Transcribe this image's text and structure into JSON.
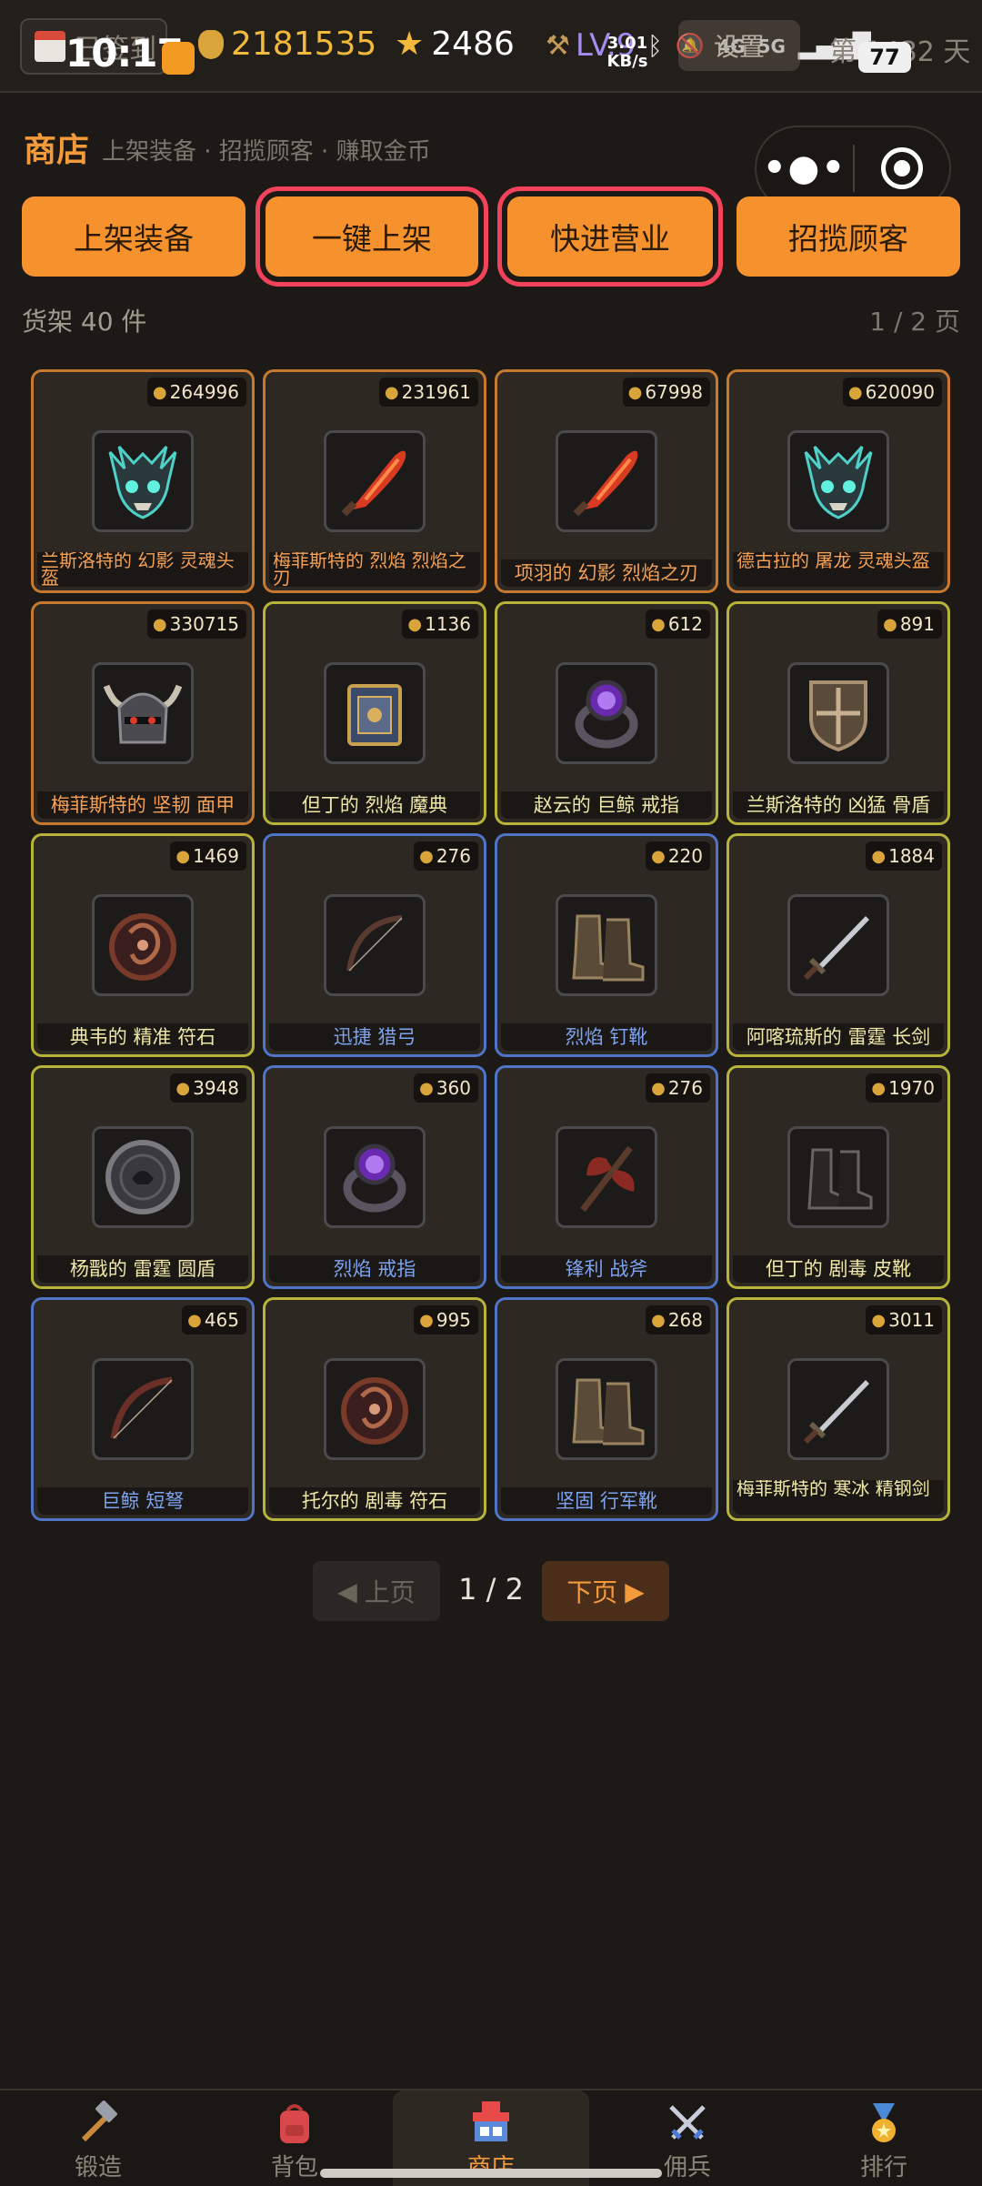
{
  "status_bar": {
    "clock": "10:17",
    "checkin_label": "已签到",
    "gold": "2181535",
    "stars": "2486",
    "level": "LV.9",
    "net_speed_value": "3.01",
    "net_speed_unit": "KB/s",
    "network_labels": [
      "4G",
      "5G"
    ],
    "settings_label": "设置",
    "day_count": "第 1432 天",
    "battery": "77"
  },
  "header": {
    "title": "商店",
    "subtitle": "上架装备 · 招揽顾客 · 赚取金币"
  },
  "actions": [
    {
      "label": "上架装备",
      "highlighted": false
    },
    {
      "label": "一键上架",
      "highlighted": true
    },
    {
      "label": "快进营业",
      "highlighted": true
    },
    {
      "label": "招揽顾客",
      "highlighted": false
    }
  ],
  "shelf": {
    "count_label": "货架 40 件",
    "page_label": "1 / 2 页"
  },
  "items": [
    {
      "price": "264996",
      "name": "兰斯洛特的 幻影 灵魂头盔",
      "quality": "orange",
      "icon": "demon-helm-icon"
    },
    {
      "price": "231961",
      "name": "梅菲斯特的 烈焰 烈焰之刃",
      "quality": "orange",
      "icon": "flame-blade-icon"
    },
    {
      "price": "67998",
      "name": "项羽的 幻影 烈焰之刃",
      "quality": "orange",
      "icon": "flame-blade-icon"
    },
    {
      "price": "620090",
      "name": "德古拉的 屠龙 灵魂头盔",
      "quality": "orange",
      "icon": "demon-helm-icon"
    },
    {
      "price": "330715",
      "name": "梅菲斯特的 坚韧 面甲",
      "quality": "orange",
      "icon": "horned-helmet-icon"
    },
    {
      "price": "1136",
      "name": "但丁的 烈焰 魔典",
      "quality": "yellow",
      "icon": "tome-icon"
    },
    {
      "price": "612",
      "name": "赵云的 巨鲸 戒指",
      "quality": "yellow",
      "icon": "purple-ring-icon"
    },
    {
      "price": "891",
      "name": "兰斯洛特的 凶猛 骨盾",
      "quality": "yellow",
      "icon": "bone-shield-icon"
    },
    {
      "price": "1469",
      "name": "典韦的 精准 符石",
      "quality": "yellow",
      "icon": "rune-stone-icon"
    },
    {
      "price": "276",
      "name": "迅捷 猎弓",
      "quality": "blue",
      "icon": "bow-icon"
    },
    {
      "price": "220",
      "name": "烈焰 钉靴",
      "quality": "blue",
      "icon": "boots-icon"
    },
    {
      "price": "1884",
      "name": "阿喀琉斯的 雷霆 长剑",
      "quality": "yellow",
      "icon": "longsword-icon"
    },
    {
      "price": "3948",
      "name": "杨戬的 雷霆 圆盾",
      "quality": "yellow",
      "icon": "round-shield-icon"
    },
    {
      "price": "360",
      "name": "烈焰 戒指",
      "quality": "blue",
      "icon": "purple-ring-icon"
    },
    {
      "price": "276",
      "name": "锋利 战斧",
      "quality": "blue",
      "icon": "battle-axe-icon"
    },
    {
      "price": "1970",
      "name": "但丁的 剧毒 皮靴",
      "quality": "yellow",
      "icon": "leather-boots-icon"
    },
    {
      "price": "465",
      "name": "巨鲸 短弩",
      "quality": "blue",
      "icon": "crossbow-icon"
    },
    {
      "price": "995",
      "name": "托尔的 剧毒 符石",
      "quality": "yellow",
      "icon": "rune-stone-icon"
    },
    {
      "price": "268",
      "name": "坚固 行军靴",
      "quality": "blue",
      "icon": "boots-icon"
    },
    {
      "price": "3011",
      "name": "梅菲斯特的 寒冰 精钢剑",
      "quality": "yellow",
      "icon": "longsword-icon"
    }
  ],
  "pagination": {
    "prev_label": "上页",
    "current": "1 / 2",
    "next_label": "下页"
  },
  "bottom_nav": [
    {
      "label": "锻造",
      "icon": "hammer-icon",
      "active": false
    },
    {
      "label": "背包",
      "icon": "backpack-icon",
      "active": false
    },
    {
      "label": "商店",
      "icon": "shop-icon",
      "active": true
    },
    {
      "label": "佣兵",
      "icon": "crossed-swords-icon",
      "active": false
    },
    {
      "label": "排行",
      "icon": "medal-icon",
      "active": false
    }
  ],
  "colors": {
    "accent": "#f6922e",
    "highlight_outline": "#f3435a",
    "quality_orange": "#c77a2f",
    "quality_yellow": "#b7b43a",
    "quality_blue": "#4f74c8"
  }
}
